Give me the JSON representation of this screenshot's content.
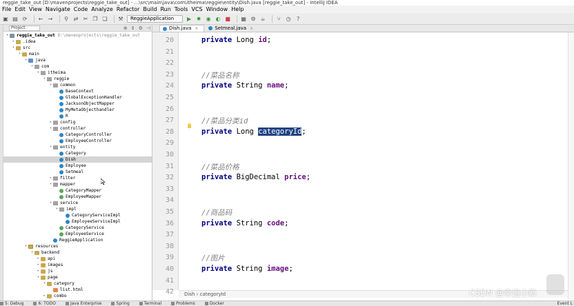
{
  "window": {
    "title": "reggie_take_out [D:\\mavenprojects\\reggie_take_out] - ...\\src\\main\\java\\com\\itheima\\reggie\\entity\\Dish.java [reggie_take_out] - IntelliJ IDEA"
  },
  "menubar": [
    "File",
    "Edit",
    "View",
    "Navigate",
    "Code",
    "Analyze",
    "Refactor",
    "Build",
    "Run",
    "Tools",
    "VCS",
    "Window",
    "Help"
  ],
  "toolbar": {
    "run_config": "ReggieApplication"
  },
  "project_panel": {
    "header_label": "Project",
    "tree": [
      {
        "level": 0,
        "label": "reggie_take_out",
        "path": "D:\\mavenprojects\\reggie_take_out",
        "icon": "module",
        "expanded": true
      },
      {
        "level": 1,
        "label": ".idea",
        "icon": "folder",
        "expanded": false
      },
      {
        "level": 1,
        "label": "src",
        "icon": "folder",
        "expanded": true
      },
      {
        "level": 2,
        "label": "main",
        "icon": "folder",
        "expanded": true
      },
      {
        "level": 3,
        "label": "java",
        "icon": "src",
        "expanded": true
      },
      {
        "level": 4,
        "label": "com",
        "icon": "pkg",
        "expanded": true
      },
      {
        "level": 5,
        "label": "itheima",
        "icon": "pkg",
        "expanded": true
      },
      {
        "level": 6,
        "label": "reggie",
        "icon": "pkg",
        "expanded": true
      },
      {
        "level": 7,
        "label": "common",
        "icon": "pkg",
        "expanded": true
      },
      {
        "level": 8,
        "label": "BaseContext",
        "icon": "cls"
      },
      {
        "level": 8,
        "label": "GlobalExceptionHandler",
        "icon": "cls"
      },
      {
        "level": 8,
        "label": "JacksonObjectMapper",
        "icon": "cls"
      },
      {
        "level": 8,
        "label": "MyMetaObjecthandler",
        "icon": "cls"
      },
      {
        "level": 8,
        "label": "R",
        "icon": "cls"
      },
      {
        "level": 7,
        "label": "config",
        "icon": "pkg",
        "expanded": false
      },
      {
        "level": 7,
        "label": "controller",
        "icon": "pkg",
        "expanded": true
      },
      {
        "level": 8,
        "label": "CategoryController",
        "icon": "cls"
      },
      {
        "level": 8,
        "label": "EmployeeController",
        "icon": "cls"
      },
      {
        "level": 7,
        "label": "entity",
        "icon": "pkg",
        "expanded": true
      },
      {
        "level": 8,
        "label": "Category",
        "icon": "cls"
      },
      {
        "level": 8,
        "label": "Dish",
        "icon": "cls",
        "selected": true
      },
      {
        "level": 8,
        "label": "Employee",
        "icon": "cls"
      },
      {
        "level": 8,
        "label": "Setmeal",
        "icon": "cls"
      },
      {
        "level": 7,
        "label": "filter",
        "icon": "pkg",
        "expanded": false
      },
      {
        "level": 7,
        "label": "mapper",
        "icon": "pkg",
        "expanded": true
      },
      {
        "level": 8,
        "label": "CategoryMapper",
        "icon": "intf"
      },
      {
        "level": 8,
        "label": "EmployeeMapper",
        "icon": "intf"
      },
      {
        "level": 7,
        "label": "service",
        "icon": "pkg",
        "expanded": true
      },
      {
        "level": 8,
        "label": "impl",
        "icon": "pkg",
        "expanded": true
      },
      {
        "level": 9,
        "label": "CategoryServiceImpl",
        "icon": "cls"
      },
      {
        "level": 9,
        "label": "EmployeeServiceImpl",
        "icon": "cls"
      },
      {
        "level": 8,
        "label": "CategoryService",
        "icon": "intf"
      },
      {
        "level": 8,
        "label": "EmployeeService",
        "icon": "intf"
      },
      {
        "level": 7,
        "label": "ReggieApplication",
        "icon": "cls"
      },
      {
        "level": 3,
        "label": "resources",
        "icon": "res",
        "expanded": true
      },
      {
        "level": 4,
        "label": "backend",
        "icon": "folder",
        "expanded": true
      },
      {
        "level": 5,
        "label": "api",
        "icon": "folder",
        "expanded": false
      },
      {
        "level": 5,
        "label": "images",
        "icon": "folder",
        "expanded": false
      },
      {
        "level": 5,
        "label": "js",
        "icon": "folder",
        "expanded": false
      },
      {
        "level": 5,
        "label": "page",
        "icon": "folder",
        "expanded": true
      },
      {
        "level": 6,
        "label": "category",
        "icon": "folder",
        "expanded": true
      },
      {
        "level": 7,
        "label": "list.html",
        "icon": "html"
      },
      {
        "level": 6,
        "label": "combo",
        "icon": "folder",
        "expanded": false
      }
    ]
  },
  "editor": {
    "tabs": [
      {
        "label": "Dish.java",
        "active": true
      },
      {
        "label": "Setmeal.java",
        "active": false
      }
    ],
    "line_numbers": [
      "20",
      "21",
      "22",
      "23",
      "24",
      "25",
      "26",
      "27",
      "28",
      "29",
      "30",
      "31",
      "32",
      "33",
      "34",
      "35",
      "36",
      "37",
      "38",
      "39",
      "40",
      "41",
      "42"
    ],
    "lines": [
      {
        "ln": "20",
        "parts": [
          [
            "kw",
            "private "
          ],
          [
            "ty",
            "Long "
          ],
          [
            "fd",
            "id"
          ],
          [
            "ty",
            ";"
          ]
        ]
      },
      {
        "ln": "23",
        "parts": [
          [
            "cm",
            "//菜品名称"
          ]
        ]
      },
      {
        "ln": "24",
        "parts": [
          [
            "kw",
            "private "
          ],
          [
            "ty",
            "String "
          ],
          [
            "fd",
            "name"
          ],
          [
            "ty",
            ";"
          ]
        ]
      },
      {
        "ln": "27",
        "parts": [
          [
            "cm",
            "//菜品分类id"
          ]
        ]
      },
      {
        "ln": "28",
        "parts": [
          [
            "kw",
            "private "
          ],
          [
            "ty",
            "Long "
          ],
          [
            "sel",
            "categoryId"
          ],
          [
            "ty",
            ";"
          ]
        ]
      },
      {
        "ln": "31",
        "parts": [
          [
            "cm",
            "//菜品价格"
          ]
        ]
      },
      {
        "ln": "32",
        "parts": [
          [
            "kw",
            "private "
          ],
          [
            "ty",
            "BigDecimal "
          ],
          [
            "fd",
            "price"
          ],
          [
            "ty",
            ";"
          ]
        ]
      },
      {
        "ln": "35",
        "parts": [
          [
            "cm",
            "//商品码"
          ]
        ]
      },
      {
        "ln": "36",
        "parts": [
          [
            "kw",
            "private "
          ],
          [
            "ty",
            "String "
          ],
          [
            "fd",
            "code"
          ],
          [
            "ty",
            ";"
          ]
        ]
      },
      {
        "ln": "39",
        "parts": [
          [
            "cm",
            "//图片"
          ]
        ]
      },
      {
        "ln": "40",
        "parts": [
          [
            "kw",
            "private "
          ],
          [
            "ty",
            "String "
          ],
          [
            "fd",
            "image"
          ],
          [
            "ty",
            ";"
          ]
        ]
      }
    ],
    "breadcrumb": "Dish  ›  categoryId"
  },
  "statusbar": {
    "items": [
      "5: Debug",
      "6: TODO",
      "Java Enterprise",
      "Spring",
      "Terminal",
      "Problems",
      "Docker"
    ],
    "right": "Event L"
  },
  "watermark": "CSDN @幸运小新"
}
